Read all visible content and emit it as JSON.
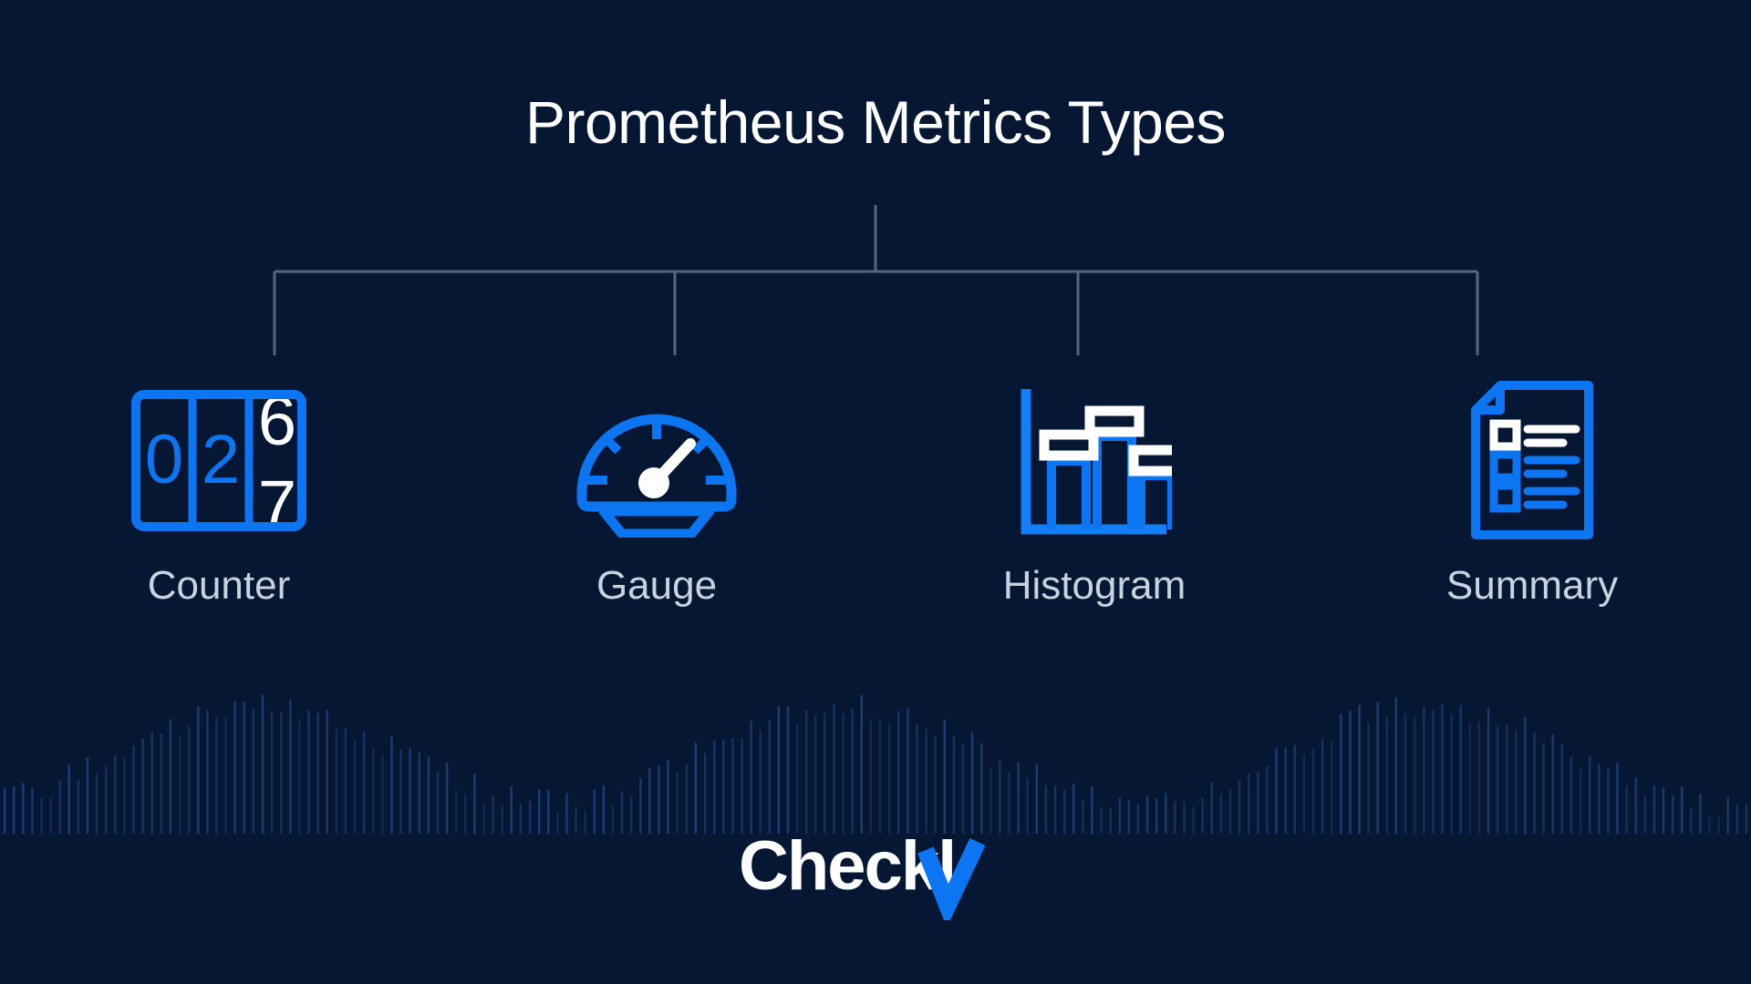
{
  "page": {
    "title": "Prometheus Metrics Types",
    "background_color": "#061733",
    "accent_blue": "#0c75f2",
    "label_color": "#c5d4de",
    "title_color": "#ffffff",
    "connector_color": "#55657f"
  },
  "diagram": {
    "root_label": "Prometheus Metrics Types",
    "nodes": [
      {
        "label": "Counter",
        "icon": "odometer-counter-icon"
      },
      {
        "label": "Gauge",
        "icon": "speedometer-gauge-icon"
      },
      {
        "label": "Histogram",
        "icon": "bar-histogram-icon"
      },
      {
        "label": "Summary",
        "icon": "document-checklist-icon"
      }
    ]
  },
  "counter_icon": {
    "digits": [
      "0",
      "2"
    ],
    "rolling_digit_top": "6",
    "rolling_digit_bottom": "7"
  },
  "gauge_icon": {
    "tick_count": 5,
    "needle_color": "#ffffff"
  },
  "histogram_icon": {
    "bar_count": 3,
    "label_box_count": 3
  },
  "summary_icon": {
    "row_count": 3,
    "highlighted_row": 1
  },
  "waveform": {
    "bar_count": 190,
    "color": "#1b3f78"
  },
  "branding": {
    "wordmark": "Checkl",
    "wordmark_full": "Checkly",
    "check_color": "#0c75f2",
    "text_color": "#ffffff"
  }
}
